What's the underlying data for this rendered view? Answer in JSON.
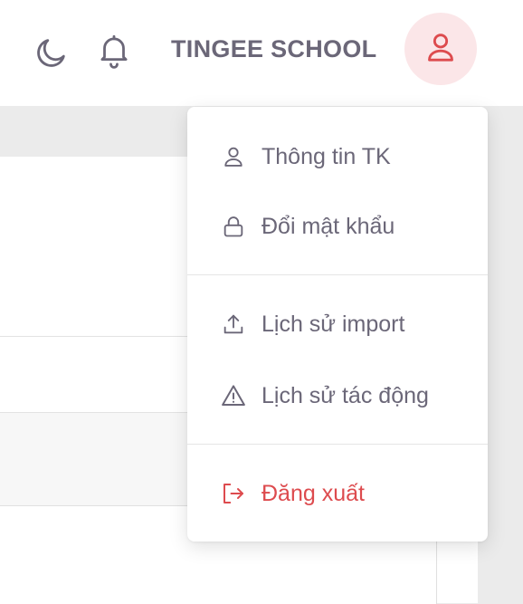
{
  "header": {
    "brand": "TINGEE SCHOOL",
    "theme_icon": "moon-icon",
    "notification_icon": "bell-icon",
    "avatar_icon": "user-icon"
  },
  "user_menu": {
    "items": [
      {
        "label": "Thông tin TK",
        "icon": "user-icon"
      },
      {
        "label": "Đổi mật khẩu",
        "icon": "lock-icon"
      },
      {
        "label": "Lịch sử import",
        "icon": "upload-icon"
      },
      {
        "label": "Lịch sử tác động",
        "icon": "warning-icon"
      },
      {
        "label": "Đăng xuất",
        "icon": "logout-icon"
      }
    ]
  },
  "colors": {
    "text_muted": "#6b6778",
    "danger": "#dd4b4e",
    "avatar_bg": "#fbe6e8"
  }
}
